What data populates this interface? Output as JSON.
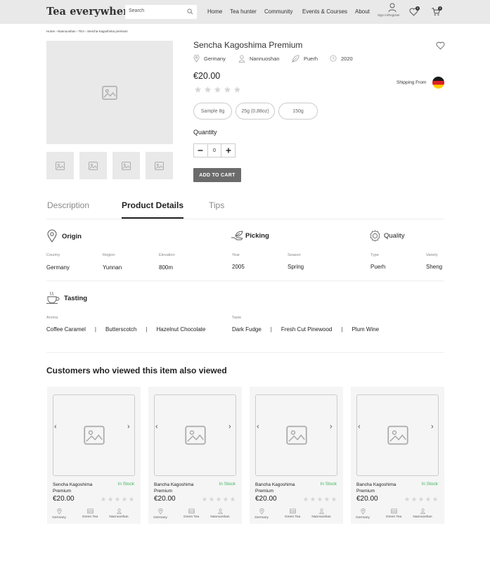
{
  "header": {
    "logo": "Tea everywhere",
    "search_placeholder": "Search",
    "nav": [
      "Home",
      "Tea hunter",
      "Community",
      "Events & Courses",
      "About"
    ],
    "signin": "Sign in/Register",
    "wishlist_count": "0",
    "cart_count": "0"
  },
  "breadcrumb": "Home › Nannuoshan › TEA › Sencha Kagoshima premium",
  "product": {
    "title": "Sencha Kagoshima Premium",
    "meta": [
      "Germany",
      "Nannuoshan",
      "Puerh",
      "2020"
    ],
    "price": "€20.00",
    "rating": 0,
    "shipping_label": "Shipping From",
    "options": [
      "Sample 8g",
      "25g (0,88oz)",
      "150g"
    ],
    "quantity_label": "Quantity",
    "quantity": "0",
    "add_to_cart": "ADD TO CART"
  },
  "tabs": [
    "Description",
    "Product Details",
    "Tips"
  ],
  "details": {
    "origin": {
      "title": "Origin",
      "fields": [
        {
          "label": "Country",
          "value": "Germany"
        },
        {
          "label": "Region",
          "value": "Yunnan"
        },
        {
          "label": "Elevation",
          "value": "800m"
        }
      ]
    },
    "picking": {
      "title": "Picking",
      "fields": [
        {
          "label": "Year",
          "value": "2005"
        },
        {
          "label": "Season",
          "value": "Spring"
        }
      ]
    },
    "quality": {
      "title": "Quality",
      "fields": [
        {
          "label": "Type",
          "value": "Puerh"
        },
        {
          "label": "Variety",
          "value": "Sheng"
        }
      ]
    },
    "tasting": {
      "title": "Tasting",
      "aroma_label": "Aroma",
      "aroma": [
        "Coffee Caramel",
        "Butterscotch",
        "Hazelnut Chocolate"
      ],
      "taste_label": "Taste",
      "taste": [
        "Dark Fudge",
        "Fresh Cut Pinewood",
        "Plum Wine"
      ]
    }
  },
  "also_viewed": {
    "title": "Customers who viewed this item also viewed",
    "cards": [
      {
        "name": "Sencha Kagoshima Premium",
        "stock": "In Stock",
        "price": "€20.00",
        "meta": [
          "Germany",
          "Green Tea",
          "Nannuoshan"
        ]
      },
      {
        "name": "Bancha Kagoshima Premium",
        "stock": "In Stock",
        "price": "€20.00",
        "meta": [
          "Germany",
          "Green Tea",
          "Nannuoshan"
        ]
      },
      {
        "name": "Bancha Kagoshima Premium",
        "stock": "In Stock",
        "price": "€20.00",
        "meta": [
          "Germany",
          "Green Tea",
          "Nannuoshan"
        ]
      },
      {
        "name": "Bancha Kagoshima Premium",
        "stock": "In Stock",
        "price": "€20.00",
        "meta": [
          "Germany",
          "Green Tea",
          "Nannuoshan"
        ]
      }
    ]
  },
  "colors": {
    "in_stock": "#3fb65f",
    "button": "#6b6b6b",
    "header_bg": "#e9e9e9"
  }
}
